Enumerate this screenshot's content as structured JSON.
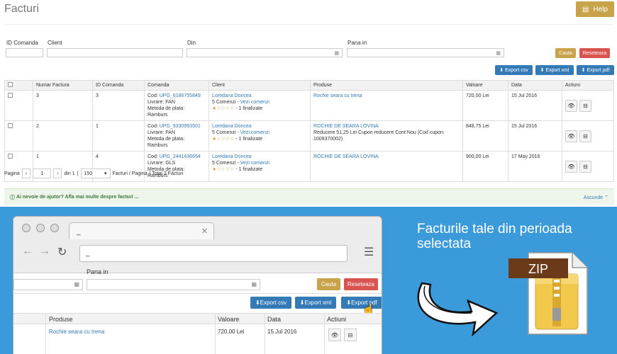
{
  "header": {
    "title": "Facturi",
    "help_label": "Help"
  },
  "filters": {
    "id_comanda_label": "ID Comanda",
    "client_label": "Client",
    "din_label": "Din",
    "pana_label": "Pana in",
    "search_label": "Cauta",
    "reset_label": "Reseteaza"
  },
  "exports": {
    "csv": "Export csv",
    "xml": "Export xml",
    "pdf": "Export pdf"
  },
  "table": {
    "headers": [
      "Numar Factura",
      "ID Comanda",
      "Comanda",
      "Client",
      "Produse",
      "Valoare",
      "Data",
      "Actiuni"
    ],
    "rows": [
      {
        "nr": "3",
        "id": "3",
        "cod_label": "Cod:",
        "cod": "UPG_6186755849",
        "livrare": "Livrare: FAN",
        "plata": "Metoda de plata: Ramburs",
        "client": "Loredana Doncea",
        "comenzi": "5 Comenzi -",
        "vezi": "Vezi comenzi",
        "finalizate": "- 1 finalizate",
        "produs": "Rochie seara cu trena",
        "produs_extra": "",
        "valoare": "720,00 Lei",
        "data": "15 Jul 2016"
      },
      {
        "nr": "2",
        "id": "1",
        "cod_label": "Cod:",
        "cod": "UPG_9330993501",
        "livrare": "Livrare: FAN",
        "plata": "Metoda de plata: Ramburs",
        "client": "Loredana Doncea",
        "comenzi": "5 Comenzi -",
        "vezi": "Vezi comenzi",
        "finalizate": "- 1 finalizate",
        "produs": "ROCHIE DE SEARA LOVINA",
        "produs_extra": "Reducere 51,25 Lei Cupon reducere Cont Nou (Cod cupon: 1009370002)",
        "valoare": "848,75 Lei",
        "data": "15 Jul 2016"
      },
      {
        "nr": "1",
        "id": "4",
        "cod_label": "Cod:",
        "cod": "UPG_2441436654",
        "livrare": "Livrare: GLS",
        "plata": "Metoda de plata: Ramburs",
        "client": "Loredana Doncea",
        "comenzi": "5 Comenzi -",
        "vezi": "Vezi comenzi",
        "finalizate": "- 1 finalizate",
        "produs": "ROCHIE DE SEARA LOVINA",
        "produs_extra": "",
        "valoare": "900,00 Lei",
        "data": "17 May 2016"
      }
    ]
  },
  "pager": {
    "pagina_label": "Pagina",
    "page": "1",
    "din_text": "din 1",
    "per_page": "150",
    "per_page_text": "Facturi / Pagina",
    "total_text": "| Total 3 Facturi"
  },
  "info": {
    "text": "Ai nevoie de ajutor? Afla mai multe despre facturi ...",
    "collapse": "Ascunde"
  },
  "promo": {
    "text": "Facturile tale din perioada selectata",
    "zip_label": "ZIP",
    "browser": {
      "tab_title": "_",
      "address": "_",
      "pana_label": "Pana in",
      "search_label": "Cauta",
      "reset_label": "Reseteaza",
      "headers": [
        "Produse",
        "Valoare",
        "Data",
        "Actiuni"
      ],
      "row": {
        "produs": "Rochie seara cu trena",
        "valoare": "720,00 Lei",
        "data": "15 Jul 2016"
      }
    }
  },
  "colors": {
    "accent": "#c9a34a",
    "danger": "#d9534f",
    "primary": "#337ab7",
    "promo_bg": "#3b9ad9"
  }
}
